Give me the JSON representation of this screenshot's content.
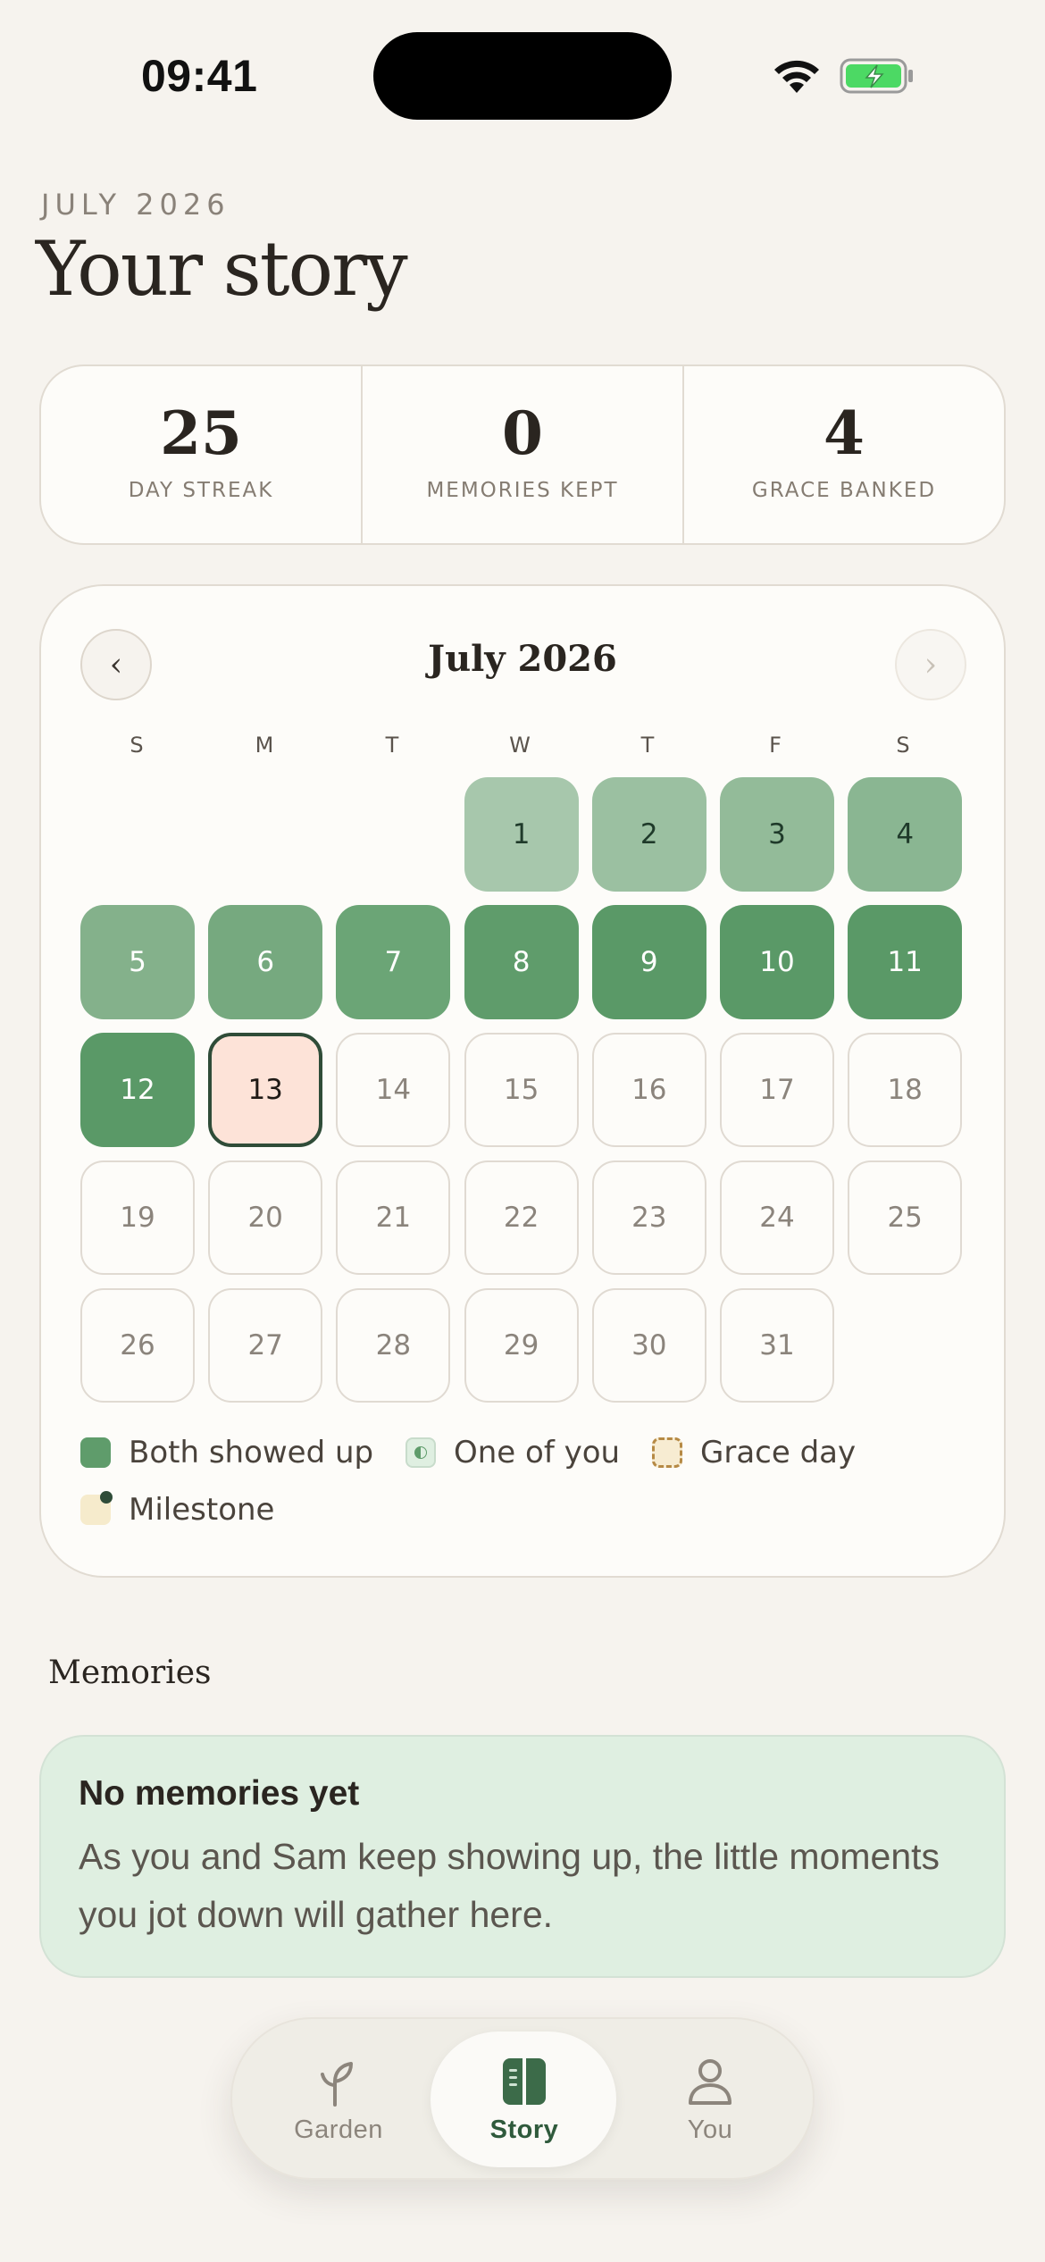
{
  "status": {
    "time": "09:41"
  },
  "header": {
    "eyebrow": "JULY 2026",
    "title": "Your story"
  },
  "stats": [
    {
      "value": "25",
      "label": "DAY STREAK"
    },
    {
      "value": "0",
      "label": "MEMORIES KEPT"
    },
    {
      "value": "4",
      "label": "GRACE BANKED"
    }
  ],
  "calendar": {
    "month": "July 2026",
    "prev": "‹",
    "next": "›",
    "weekdays": [
      "S",
      "M",
      "T",
      "W",
      "T",
      "F",
      "S"
    ],
    "first_weekday_index": 3,
    "today": 13,
    "days": [
      "1",
      "2",
      "3",
      "4",
      "5",
      "6",
      "7",
      "8",
      "9",
      "10",
      "11",
      "12",
      "13",
      "14",
      "15",
      "16",
      "17",
      "18",
      "19",
      "20",
      "21",
      "22",
      "23",
      "24",
      "25",
      "26",
      "27",
      "28",
      "29",
      "30",
      "31"
    ],
    "completed_through": 12,
    "completed_colors": [
      "#a7c7ac",
      "#9bc0a1",
      "#93bb99",
      "#8ab692",
      "#84b18b",
      "#76a97f",
      "#6ba576",
      "#5f9c6b",
      "#5a9967",
      "#5a9967",
      "#5a9967",
      "#5a9967"
    ]
  },
  "legend": {
    "both": "Both showed up",
    "one": "One of you",
    "grace": "Grace day",
    "milestone": "Milestone"
  },
  "memories": {
    "section_title": "Memories",
    "empty_title": "No memories yet",
    "empty_body": "As you and Sam keep showing up, the little moments you jot down will gather here."
  },
  "tabs": [
    {
      "label": "Garden",
      "icon": "sprout-icon",
      "active": false
    },
    {
      "label": "Story",
      "icon": "book-icon",
      "active": true
    },
    {
      "label": "You",
      "icon": "person-icon",
      "active": false
    }
  ]
}
